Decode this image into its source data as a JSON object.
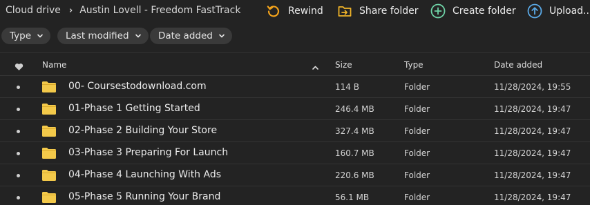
{
  "breadcrumb": {
    "root": "Cloud drive",
    "current": "Austin Lovell - Freedom FastTrack"
  },
  "toolbar": {
    "rewind_label": "Rewind",
    "share_label": "Share folder",
    "create_label": "Create folder",
    "upload_label": "Upload..."
  },
  "filters": {
    "type_label": "Type",
    "last_modified_label": "Last modified",
    "date_added_label": "Date added"
  },
  "table": {
    "headers": {
      "name": "Name",
      "size": "Size",
      "type": "Type",
      "date_added": "Date added"
    },
    "rows": [
      {
        "name": "00- Coursestodownload.com",
        "size": "114 B",
        "type": "Folder",
        "date_added": "11/28/2024, 19:55"
      },
      {
        "name": "01-Phase 1 Getting Started",
        "size": "246.4 MB",
        "type": "Folder",
        "date_added": "11/28/2024, 19:47"
      },
      {
        "name": "02-Phase 2 Building Your Store",
        "size": "327.4 MB",
        "type": "Folder",
        "date_added": "11/28/2024, 19:47"
      },
      {
        "name": "03-Phase 3 Preparing For Launch",
        "size": "160.7 MB",
        "type": "Folder",
        "date_added": "11/28/2024, 19:47"
      },
      {
        "name": "04-Phase 4 Launching With Ads",
        "size": "220.6 MB",
        "type": "Folder",
        "date_added": "11/28/2024, 19:47"
      },
      {
        "name": "05-Phase 5 Running Your Brand",
        "size": "56.1 MB",
        "type": "Folder",
        "date_added": "11/28/2024, 19:47"
      }
    ]
  },
  "icons": {
    "rewind": "rewind-icon",
    "share": "share-folder-icon",
    "create": "plus-circle-icon",
    "upload": "upload-icon",
    "favourite": "heart-icon",
    "sort": "chevron-up-icon",
    "folder": "folder-icon"
  },
  "colors": {
    "background": "#232323",
    "rewind": "#f2a21b",
    "share": "#f0b429",
    "create": "#6fd3a7",
    "upload": "#5aa9e6",
    "folder": "#f3c94a",
    "chip": "#3a3a3a"
  }
}
